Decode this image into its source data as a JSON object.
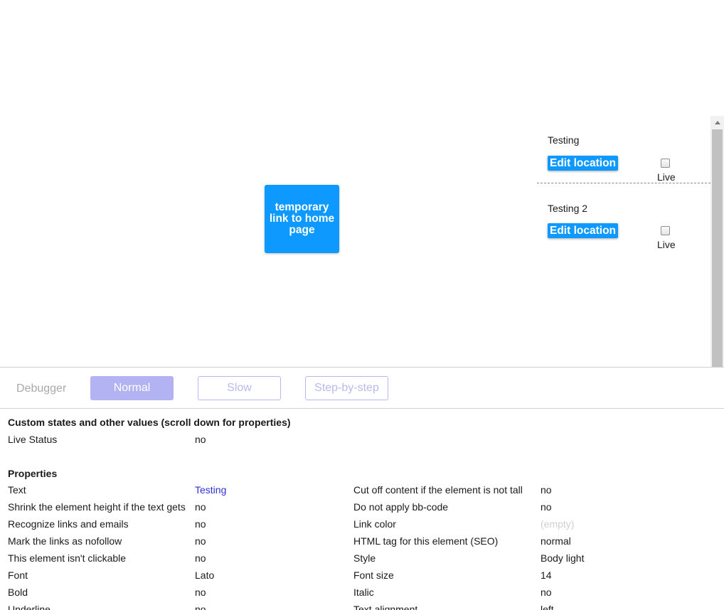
{
  "canvas": {
    "home_link_label": "temporary link to home page",
    "repeating_group": {
      "cells": [
        {
          "name": "Testing",
          "button_label": "Edit location",
          "checkbox_label": "Live",
          "checked": false
        },
        {
          "name": "Testing 2",
          "button_label": "Edit location",
          "checkbox_label": "Live",
          "checked": false
        }
      ]
    }
  },
  "debugger": {
    "title": "Debugger",
    "modes": [
      "Normal",
      "Slow",
      "Step-by-step"
    ],
    "active_mode": "Normal",
    "colors": {
      "active_mode_bg": "#b3b3f3",
      "inactive_mode_border": "#b9b9ef",
      "accent_blue": "#0d99ff"
    }
  },
  "inspector": {
    "custom_states_title": "Custom states and other values (scroll down for properties)",
    "custom_states": [
      {
        "key": "Live Status",
        "value": "no"
      }
    ],
    "properties_title": "Properties",
    "properties_left": [
      {
        "key": "Text",
        "value": "Testing"
      },
      {
        "key": "Shrink the element height if the text gets",
        "value": "no"
      },
      {
        "key": "Recognize links and emails",
        "value": "no"
      },
      {
        "key": "Mark the links as nofollow",
        "value": "no"
      },
      {
        "key": "This element isn't clickable",
        "value": "no"
      },
      {
        "key": "Font",
        "value": "Lato"
      },
      {
        "key": "Bold",
        "value": "no"
      },
      {
        "key": "Underline",
        "value": "no"
      }
    ],
    "properties_right": [
      {
        "key": "Cut off content if the element is not tall",
        "value": "no"
      },
      {
        "key": "Do not apply bb-code",
        "value": "no"
      },
      {
        "key": "Link color",
        "value": "(empty)"
      },
      {
        "key": "HTML tag for this element (SEO)",
        "value": "normal"
      },
      {
        "key": "Style",
        "value": "Body light"
      },
      {
        "key": "Font size",
        "value": "14"
      },
      {
        "key": "Italic",
        "value": "no"
      },
      {
        "key": "Text alignment",
        "value": "left"
      }
    ]
  }
}
